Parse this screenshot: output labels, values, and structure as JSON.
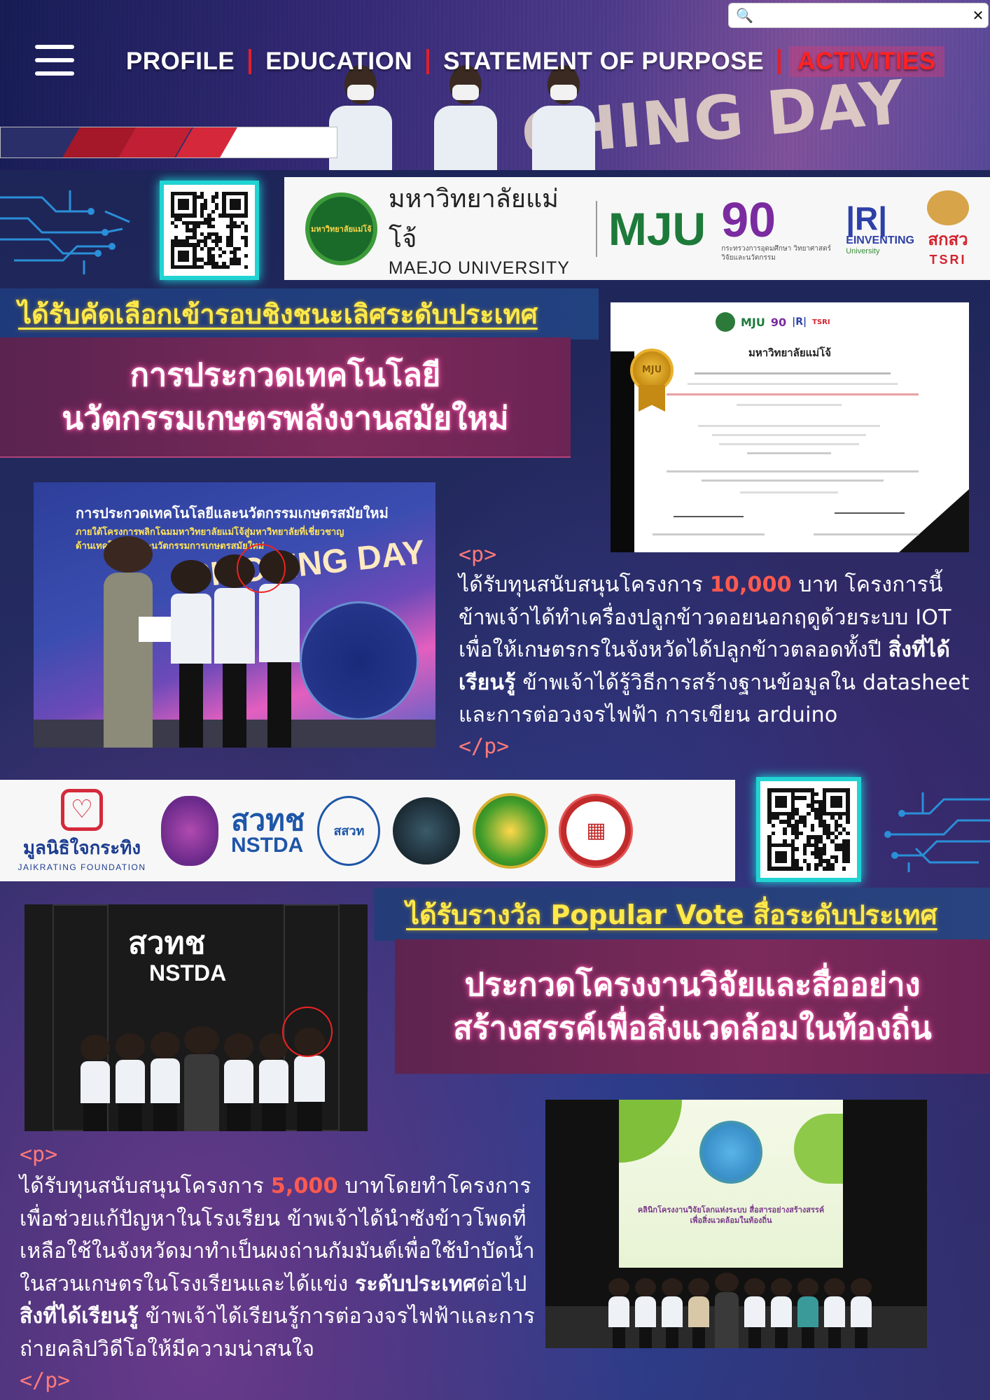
{
  "header": {
    "bg_text_big": "CHING DAY",
    "search": {
      "value": "",
      "placeholder": ""
    },
    "nav": [
      {
        "label": "PROFILE",
        "active": false
      },
      {
        "label": "EDUCATION",
        "active": false
      },
      {
        "label": "STATEMENT OF PURPOSE",
        "active": false
      },
      {
        "label": "ACTIVITIES",
        "active": true
      }
    ],
    "colors": {
      "accent_red": "#e0202b",
      "active_text": "#ff2222"
    }
  },
  "banner1": {
    "mju_logo_text": "มหาวิทยาลัยแม่โจ้",
    "mju_th": "มหาวิทยาลัยแม่โจ้",
    "mju_en": "MAEJO UNIVERSITY",
    "mju_mark": "MJU",
    "anniv_mark": "90",
    "anniv_caption": "กระทรวงการอุดมศึกษา วิทยาศาสตร์ วิจัยและนวัตกรรม",
    "einventing": "EINVENTING",
    "einventing_sub": "University",
    "tsri_th": "สกสว",
    "tsri_en": "TSRI"
  },
  "section1": {
    "tag": "ได้รับคัดเลือกเข้ารอบชิงชนะเลิศระดับประเทศ",
    "title_line1": "การประกวดเทคโนโลยี",
    "title_line2": "นวัตกรรมเกษตรพลังงานสมัยใหม่",
    "certificate": {
      "heading": "มหาวิทยาลัยแม่โจ้",
      "medal": "MJU"
    },
    "photo_banner_text": "การประกวดเทคโนโลยีและนวัตกรรมเกษตรสมัยใหม่",
    "photo_sub1": "ภายใต้โครงการพลิกโฉมมหาวิทยาลัยแม่โจ้สู่มหาวิทยาลัยที่เชี่ยวชาญ",
    "photo_sub2": "ด้านเทคโนโลยีและนวัตกรรมการเกษตรสมัยใหม่",
    "photo_day": "PITCHING DAY",
    "p_open": "<p>",
    "p_close": "</p>",
    "text_a": "ได้รับทุนสนับสนุนโครงการ ",
    "amount": "10,000",
    "text_b": " บาท โครงการนี้ข้าพเจ้าได้ทำเครื่องปลูกข้าวดอยนอกฤดูด้วยระบบ IOT เพื่อให้เกษตรกรในจังหวัดได้ปลูกข้าวตลอดทั้งปี ",
    "learned_label": "สิ่งที่ได้เรียนรู้",
    "text_c": " ข้าพเจ้าได้รู้วิธีการสร้างฐานข้อมูลใน datasheet และการต่อวงจรไฟฟ้า การเขียน arduino"
  },
  "banner2": {
    "jaikrating_th": "มูลนิธิใจกระทิง",
    "jaikrating_en": "JAIKRATING FOUNDATION",
    "nstda_th": "สวทช",
    "nstda_en": "NSTDA",
    "sasat": "สสวท"
  },
  "section2": {
    "tag": "ได้รับรางวัล Popular Vote สื่อระดับประเทศ",
    "title_line1": "ประกวดโครงงานวิจัยและสื่ออย่าง",
    "title_line2": "สร้างสรรค์เพื่อสิ่งแวดล้อมในท้องถิ่น",
    "photo_logo_th": "สวทช",
    "photo_logo_en": "NSTDA",
    "screen_title": "คลินิกโครงงานวิจัยโลกแห่งระบบ สื่อสารอย่างสร้างสรรค์ เพื่อสิ่งแวดล้อมในท้องถิ่น",
    "p_open": "<p>",
    "p_close": "</p>",
    "text_a": "ได้รับทุนสนับสนุนโครงการ ",
    "amount": "5,000",
    "text_b": " บาทโดยทำโครงการเพื่อช่วยแก้ปัญหาในโรงเรียน ข้าพเจ้าได้นำซังข้าวโพดที่เหลือใช้ในจังหวัดมาทำเป็นผงถ่านกัมมันต์เพื่อใช้บำบัดน้ำในสวนเกษตรในโรงเรียนและได้แข่ง ",
    "level": "ระดับประเทศ",
    "text_c": "ต่อไป",
    "learned_label": "สิ่งที่ได้เรียนรู้",
    "text_d": " ข้าพเจ้าได้เรียนรู้การต่อวงจรไฟฟ้าและการถ่ายคลิปวิดีโอให้มีความน่าสนใจ"
  }
}
